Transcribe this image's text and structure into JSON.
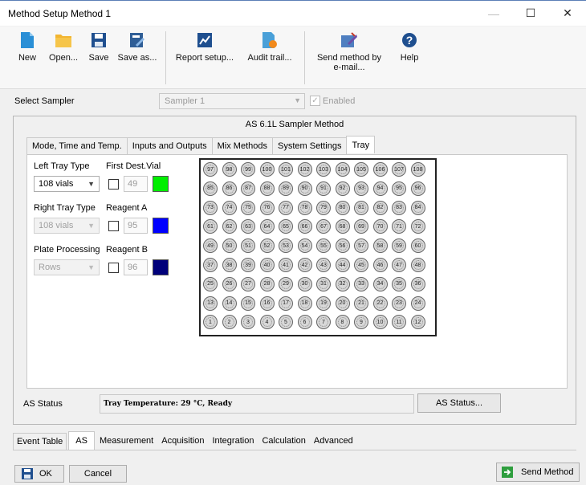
{
  "window": {
    "title": "Method Setup Method 1",
    "minimize": "—",
    "maximize": "☐",
    "close": "✕"
  },
  "toolbar": [
    {
      "label": "New",
      "icon": "new-document-icon",
      "color": "#2a8fd6"
    },
    {
      "label": "Open...",
      "icon": "open-folder-icon",
      "color": "#f2b531"
    },
    {
      "label": "Save",
      "icon": "save-icon",
      "color": "#1f4f8f"
    },
    {
      "label": "Save as...",
      "icon": "save-as-icon",
      "color": "#2f5e96"
    },
    {
      "label": "Report setup...",
      "icon": "report-setup-icon",
      "color": "#1f4f8f"
    },
    {
      "label": "Audit trail...",
      "icon": "audit-trail-icon",
      "color": "#4aa0d8"
    },
    {
      "label": "Send method by e-mail...",
      "icon": "send-email-icon",
      "color": "#6b4fa8"
    },
    {
      "label": "Help",
      "icon": "help-icon",
      "color": "#1f4f8f"
    }
  ],
  "sampler": {
    "label": "Select Sampler",
    "value": "Sampler 1",
    "enabled_label": "Enabled"
  },
  "panel": {
    "title": "AS 6.1L Sampler Method",
    "tabs": [
      "Mode, Time and Temp.",
      "Inputs and Outputs",
      "Mix Methods",
      "System Settings",
      "Tray"
    ],
    "active_tab": "Tray"
  },
  "tray_settings": {
    "left_tray_label": "Left Tray Type",
    "left_tray_value": "108 vials",
    "right_tray_label": "Right Tray Type",
    "right_tray_value": "108 vials",
    "plate_label": "Plate Processing",
    "plate_value": "Rows",
    "first_dest_label": "First Dest.Vial",
    "first_dest_value": "49",
    "first_dest_color": "#00ee00",
    "reagent_a_label": "Reagent A",
    "reagent_a_value": "95",
    "reagent_a_color": "#0000ff",
    "reagent_b_label": "Reagent B",
    "reagent_b_value": "96",
    "reagent_b_color": "#00007a"
  },
  "tray_rows": [
    [
      "97",
      "98",
      "99",
      "100",
      "101",
      "102",
      "103",
      "104",
      "105",
      "106",
      "107",
      "108"
    ],
    [
      "85",
      "86",
      "87",
      "88",
      "89",
      "90",
      "91",
      "92",
      "93",
      "94",
      "95",
      "96"
    ],
    [
      "73",
      "74",
      "75",
      "76",
      "77",
      "78",
      "79",
      "80",
      "81",
      "82",
      "83",
      "84"
    ],
    [
      "61",
      "62",
      "63",
      "64",
      "65",
      "66",
      "67",
      "68",
      "69",
      "70",
      "71",
      "72"
    ],
    [
      "49",
      "50",
      "51",
      "52",
      "53",
      "54",
      "55",
      "56",
      "57",
      "58",
      "59",
      "60"
    ],
    [
      "37",
      "38",
      "39",
      "40",
      "41",
      "42",
      "43",
      "44",
      "45",
      "46",
      "47",
      "48"
    ],
    [
      "25",
      "26",
      "27",
      "28",
      "29",
      "30",
      "31",
      "32",
      "33",
      "34",
      "35",
      "36"
    ],
    [
      "13",
      "14",
      "15",
      "16",
      "17",
      "18",
      "19",
      "20",
      "21",
      "22",
      "23",
      "24"
    ],
    [
      "1",
      "2",
      "3",
      "4",
      "5",
      "6",
      "7",
      "8",
      "9",
      "10",
      "11",
      "12"
    ]
  ],
  "status": {
    "label": "AS Status",
    "text": "Tray Temperature: 29 °C, Ready",
    "button": "AS Status..."
  },
  "bottom_tabs": [
    "Event Table",
    "AS",
    "Measurement",
    "Acquisition",
    "Integration",
    "Calculation",
    "Advanced"
  ],
  "bottom_active": "AS",
  "footer": {
    "ok": "OK",
    "cancel": "Cancel",
    "send": "Send Method"
  }
}
